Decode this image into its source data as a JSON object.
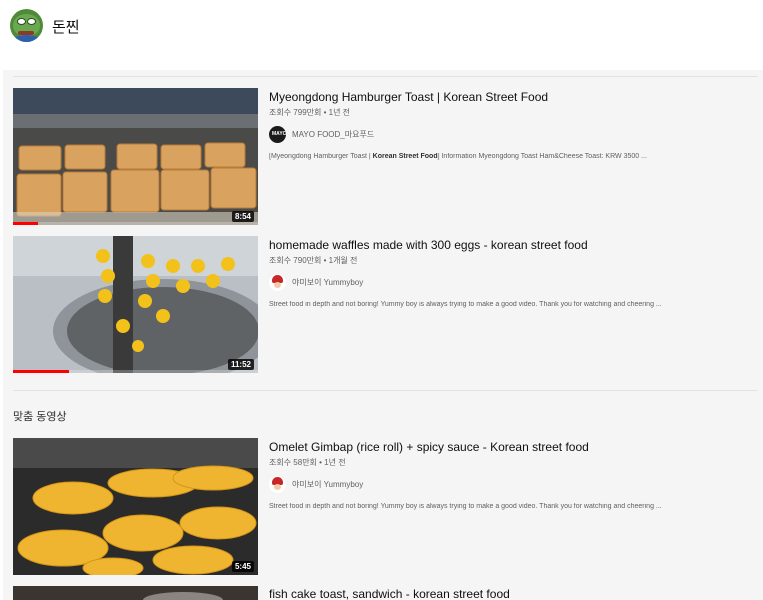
{
  "channel": {
    "name": "돈찐"
  },
  "section_heading": "맞춤 동영상",
  "colors": {
    "accent": "#ff0000",
    "panel_bg": "#f5f5f5",
    "meta_text": "#606060"
  },
  "videos": [
    {
      "title": "Myeongdong Hamburger Toast | Korean Street Food",
      "meta": "조회수 799만회 • 1년 전",
      "channel": "MAYO FOOD_마요푸드",
      "channel_icon": "mayo-food-logo",
      "description_prefix": "[Myeongdong Hamburger Toast | ",
      "description_bold": "Korean Street Food",
      "description_suffix": "] Information Myeongdong Toast Ham&Cheese Toast: KRW 3500 ...",
      "duration": "8:54",
      "watched_fraction": 0.1
    },
    {
      "title": "homemade waffles made with 300 eggs - korean street food",
      "meta": "조회수 790만회 • 1개월 전",
      "channel": "야미보이 Yummyboy",
      "channel_icon": "yummyboy-avatar",
      "description": "Street food in depth and not boring! Yummy boy is always trying to make a good video. Thank you for watching and cheering ...",
      "duration": "11:52",
      "watched_fraction": 0.23
    },
    {
      "title": "Omelet Gimbap (rice roll) + spicy sauce - Korean street food",
      "meta": "조회수 58만회 • 1년 전",
      "channel": "야미보이 Yummyboy",
      "channel_icon": "yummyboy-avatar",
      "description": "Street food in depth and not boring! Yummy boy is always trying to make a good video. Thank you for watching and cheering ...",
      "duration": "5:45",
      "watched_fraction": 0
    },
    {
      "title": "fish cake toast, sandwich - korean street food"
    }
  ]
}
